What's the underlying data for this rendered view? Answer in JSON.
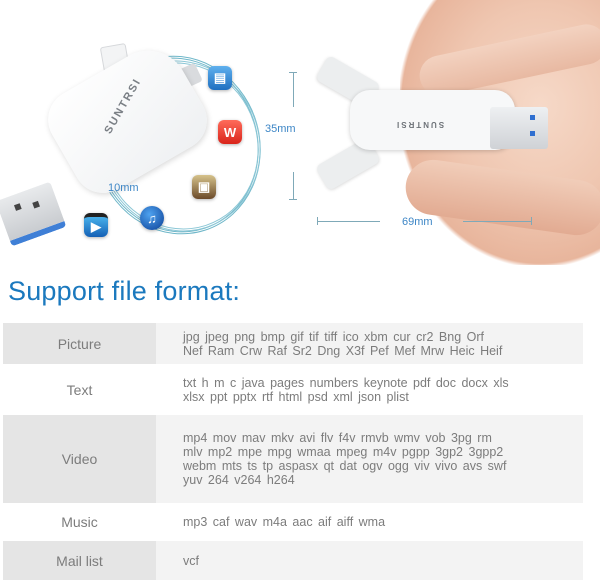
{
  "product_image": {
    "brand": "SUNTRSI",
    "dimensions": {
      "thickness": "10mm",
      "height": "35mm",
      "length": "69mm"
    },
    "app_icons": [
      "book-app-icon",
      "wps-office-icon",
      "photo-app-icon",
      "music-app-icon",
      "video-app-icon"
    ]
  },
  "heading": "Support file format:",
  "formats": [
    {
      "category": "Picture",
      "lines": [
        "jpg  jpeg  png  bmp  gif  tif  tiff  ico  xbm  cur  cr2  Bng  Orf",
        "Nef  Ram  Crw  Raf  Sr2  Dng  X3f  Pef  Mef  Mrw  Heic  Heif"
      ]
    },
    {
      "category": "Text",
      "lines": [
        "txt  h  m  c  java  pages  numbers  keynote  pdf  doc  docx  xls",
        "xlsx  ppt  pptx  rtf  html  psd  xml  json  plist"
      ]
    },
    {
      "category": "Video",
      "lines": [
        "mp4  mov  mav  mkv  avi  flv  f4v  rmvb  wmv  vob  3pg  rm",
        "mlv  mp2  mpe  mpg  wmaa  mpeg  m4v   pgpp  3gp2  3gpp2",
        "webm  mts  ts  tp  aspasx  qt  dat  ogv  ogg  viv  vivo  avs  swf",
        "yuv 264  v264  h264"
      ]
    },
    {
      "category": "Music",
      "lines": [
        "mp3  caf  wav  m4a  aac  aif  aiff  wma"
      ]
    },
    {
      "category": "Mail list",
      "lines": [
        "vcf"
      ]
    }
  ]
}
